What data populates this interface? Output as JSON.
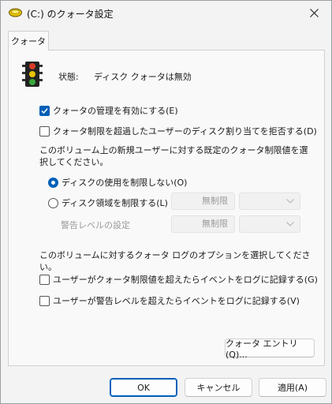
{
  "window": {
    "title": "(C:) のクォータ設定",
    "drive_icon": "drive-icon",
    "close_icon": "close-icon"
  },
  "tabs": [
    {
      "label": "クォータ",
      "selected": true
    }
  ],
  "status": {
    "icon": "traffic-light-icon",
    "label": "状態:",
    "value": "ディスク クォータは無効"
  },
  "options": {
    "enable_quota": {
      "label": "クォータの管理を有効にする(E)",
      "checked": true
    },
    "deny_space": {
      "label": "クォータ制限を超過したユーザーのディスク割り当てを拒否する(D)",
      "checked": false
    }
  },
  "default_limit": {
    "description": "このボリューム上の新規ユーザーに対する既定のクォータ制限値を選択してください。",
    "no_limit": {
      "label": "ディスクの使用を制限しない(O)",
      "selected": true
    },
    "limit": {
      "label": "ディスク領域を制限する(L)",
      "selected": false,
      "value": "無制限",
      "unit": ""
    },
    "warning": {
      "label": "警告レベルの設定",
      "value": "無制限",
      "unit": ""
    }
  },
  "logging": {
    "description": "このボリュームに対するクォータ ログのオプションを選択してください。",
    "log_limit": {
      "label": "ユーザーがクォータ制限値を超えたらイベントをログに記録する(G)",
      "checked": false
    },
    "log_warning": {
      "label": "ユーザーが警告レベルを超えたらイベントをログに記録する(V)",
      "checked": false
    }
  },
  "buttons": {
    "quota_entries": "クォータ エントリ(Q)...",
    "ok": "OK",
    "cancel": "キャンセル",
    "apply": "適用(A)"
  },
  "colors": {
    "accent": "#005fb8",
    "traffic_red": "#d83b2b",
    "traffic_yellow": "#e8c200",
    "traffic_green": "#3aa83a"
  }
}
